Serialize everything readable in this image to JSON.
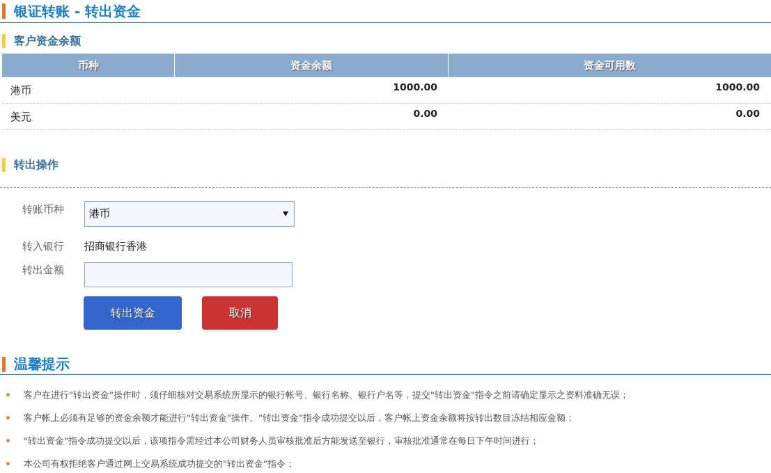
{
  "page_title": "银证转账 - 转出资金",
  "balance_section": {
    "title": "客户资金余额",
    "table": {
      "columns": [
        "币种",
        "资金余额",
        "资金可用数"
      ],
      "rows": [
        [
          "港币",
          "1000.00",
          "1000.00"
        ],
        [
          "美元",
          "0.00",
          "0.00"
        ]
      ]
    }
  },
  "transfer_section": {
    "title": "转出操作",
    "currency": {
      "label": "转账币种",
      "value": "港币"
    },
    "bank": {
      "label": "转入银行",
      "value": "招商银行香港"
    },
    "amount": {
      "label": "转出金额"
    },
    "buttons": [
      {
        "label": "转出资金",
        "kind": "primary"
      },
      {
        "label": "取消",
        "kind": "cancel"
      }
    ]
  },
  "tips": {
    "title": "温馨提示",
    "items": [
      "客户在进行\"转出资金\"操作时，须仔细核对交易系统所显示的银行帐号、银行名称、银行户名等，提交\"转出资金\"指令之前请确定显示之资料准确无误；",
      "客户帐上必须有足够的资金余额才能进行\"转出资金\"操作。\"转出资金\"指令成功提交以后，客户帐上资金余额将按转出数目冻结相应金额；",
      "\"转出资金\"指令成功提交以后，该项指令需经过本公司财务人员审核批准后方能发送至银行，审核批准通常在每日下午时间进行；",
      "本公司有权拒绝客户通过网上交易系统成功提交的\"转出资金\"指令；"
    ]
  }
}
